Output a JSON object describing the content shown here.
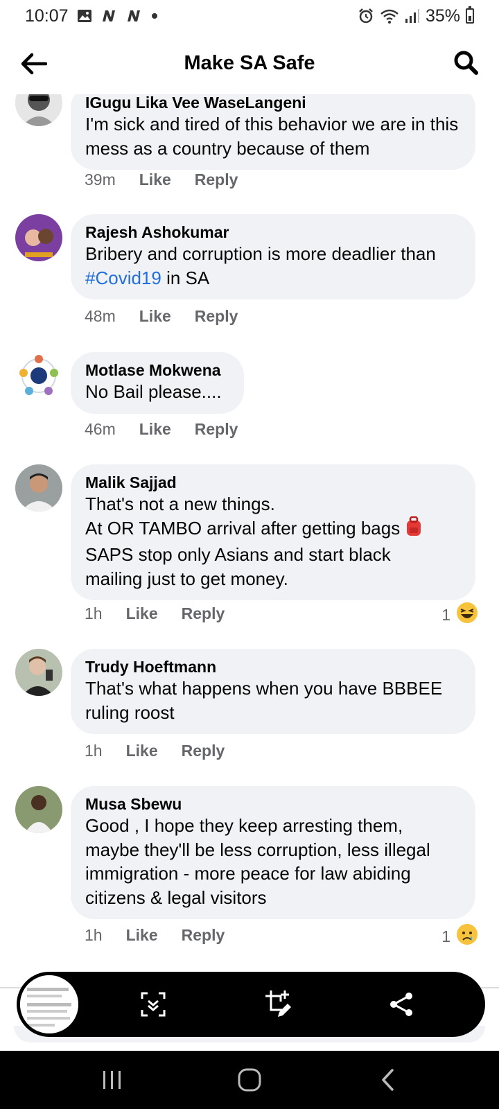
{
  "status_bar": {
    "time": "10:07",
    "left_icons": [
      "image-icon",
      "n-app-icon",
      "n-app-icon",
      "dot-icon"
    ],
    "battery_percent": "35%",
    "right_icons": [
      "alarm-icon",
      "wifi-icon",
      "signal-icon",
      "battery-icon"
    ]
  },
  "header": {
    "title": "Make SA Safe",
    "back_icon": "arrow-left-icon",
    "search_icon": "search-icon"
  },
  "comments": [
    {
      "author": "IGugu Lika Vee WaseLangeni",
      "text": "I'm sick and tired of this behavior we are in this mess as a country because of them",
      "time": "39m",
      "like": "Like",
      "reply": "Reply"
    },
    {
      "author": "Rajesh Ashokumar",
      "text_before": "Bribery and corruption is more deadlier than ",
      "hashtag": "#Covid19",
      "text_after": " in SA",
      "time": "48m",
      "like": "Like",
      "reply": "Reply"
    },
    {
      "author": "Motlase Mokwena",
      "text": "No Bail please....",
      "time": "46m",
      "like": "Like",
      "reply": "Reply"
    },
    {
      "author": "Malik Sajjad",
      "lines": [
        "That's not a new things.",
        "At OR TAMBO arrival after getting bags",
        "SAPS stop only Asians and start black",
        "mailing just to get money."
      ],
      "inline_emoji": "backpack-icon",
      "time": "1h",
      "like": "Like",
      "reply": "Reply",
      "reaction_count": "1",
      "reaction": "haha-icon"
    },
    {
      "author": "Trudy Hoeftmann",
      "text": "That's what happens when you have BBBEE ruling roost",
      "time": "1h",
      "like": "Like",
      "reply": "Reply"
    },
    {
      "author": "Musa Sbewu",
      "text": "Good , I hope they keep arresting them, maybe they'll be less corruption, less illegal immigration - more peace for law abiding citizens & legal visitors",
      "time": "1h",
      "like": "Like",
      "reply": "Reply",
      "reaction_count": "1",
      "reaction": "sad-icon"
    }
  ],
  "screenshot_toolbar": {
    "buttons": [
      "scroll-capture-icon",
      "crop-edit-icon",
      "share-icon"
    ]
  },
  "nav_bar": {
    "buttons": [
      "recent-apps-icon",
      "home-icon",
      "back-icon"
    ]
  },
  "colors": {
    "bubble": "#f0f2f5",
    "hashtag": "#216fdb",
    "meta_gray": "#65676b",
    "toolbar": "#000000"
  }
}
